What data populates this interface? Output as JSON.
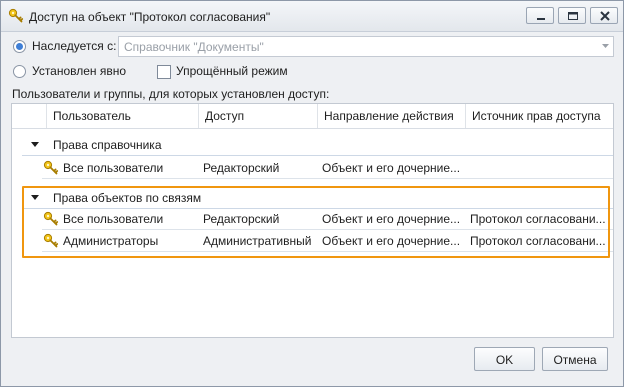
{
  "window": {
    "title": "Доступ на объект \"Протокол согласования\""
  },
  "inherit": {
    "label": "Наследуется с:",
    "value": "Справочник \"Документы\"",
    "checked": true
  },
  "explicit": {
    "label": "Установлен явно",
    "checked": false
  },
  "simple_mode": {
    "label": "Упрощённый режим",
    "checked": false
  },
  "grid_caption": "Пользователи и группы, для которых установлен доступ:",
  "columns": [
    "Пользователь",
    "Доступ",
    "Направление действия",
    "Источник прав доступа"
  ],
  "groups": [
    {
      "title": "Права справочника",
      "rows": [
        {
          "user": "Все пользователи",
          "access": "Редакторский",
          "direction": "Объект и его дочерние...",
          "source": ""
        }
      ]
    },
    {
      "title": "Права объектов по связям",
      "rows": [
        {
          "user": "Все пользователи",
          "access": "Редакторский",
          "direction": "Объект и его дочерние...",
          "source": "Протокол согласовани..."
        },
        {
          "user": "Администраторы",
          "access": "Административный",
          "direction": "Объект и его дочерние...",
          "source": "Протокол согласовани..."
        }
      ]
    }
  ],
  "buttons": {
    "ok": "OK",
    "cancel": "Отмена"
  },
  "colors": {
    "highlight": "#f0960f",
    "radio_accent": "#3f7fd6",
    "key_icon": "#e8b400"
  }
}
